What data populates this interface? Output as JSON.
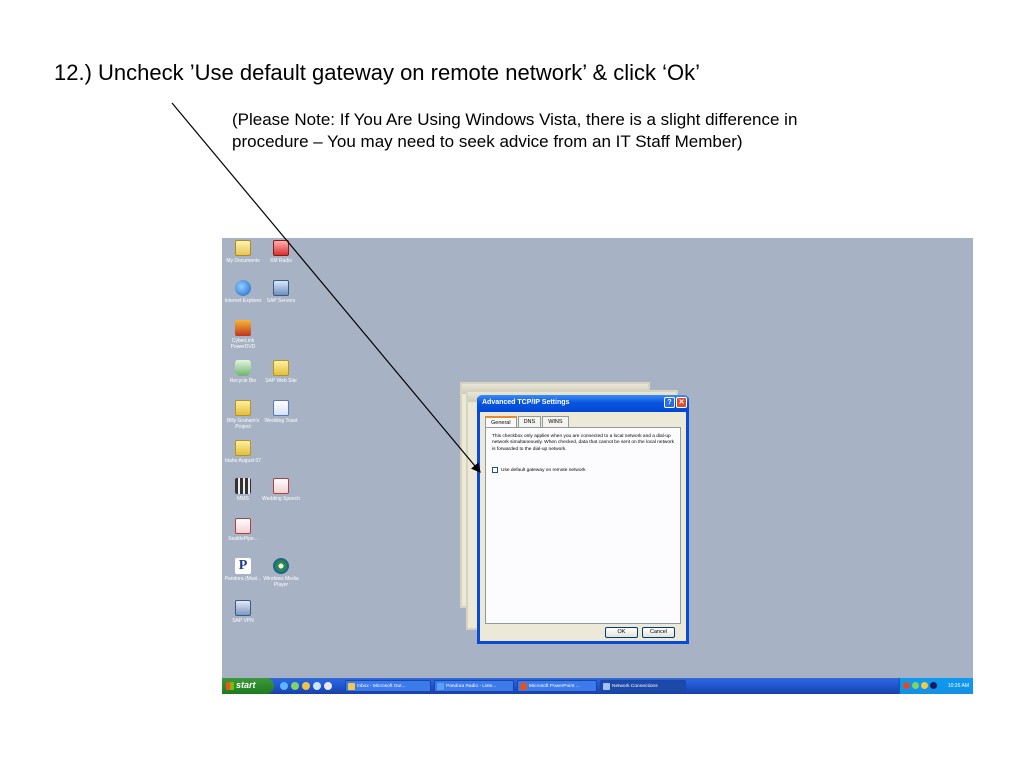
{
  "slide": {
    "title": "12.) Uncheck ’Use default gateway on remote network’ & click ‘Ok’",
    "note_line1": "(Please Note:  If You Are Using Windows Vista, there is a slight difference  in",
    "note_line2": "procedure – You may need to seek advice from an IT Staff Member)"
  },
  "desktop": {
    "background": "#a7b3c4",
    "icons": [
      {
        "label": "My Documents",
        "icon": "my-documents-icon"
      },
      {
        "label": "XM Radio",
        "icon": "xm-radio-icon"
      },
      {
        "label": "Internet Explorer",
        "icon": "internet-explorer-icon"
      },
      {
        "label": "SAP Servers",
        "icon": "sap-servers-icon"
      },
      {
        "label": "CyberLink PowerDVD",
        "icon": "powerdvd-icon"
      },
      {
        "label": "Recycle Bin",
        "icon": "recycle-bin-icon"
      },
      {
        "label": "SAP Web Site",
        "icon": "sap-web-site-icon"
      },
      {
        "label": "Billy Graham's Project",
        "icon": "folder-icon"
      },
      {
        "label": "Wedding Toast",
        "icon": "word-document-icon"
      },
      {
        "label": "Idaho August 07",
        "icon": "folder-icon"
      },
      {
        "label": "MMS",
        "icon": "mms-icon"
      },
      {
        "label": "Wedding Speech",
        "icon": "word-document-icon"
      },
      {
        "label": "SeattlePipe...",
        "icon": "pdf-icon"
      },
      {
        "label": "Pandora (Musi...",
        "icon": "pandora-icon"
      },
      {
        "label": "Windows Media Player",
        "icon": "media-player-icon"
      },
      {
        "label": "SAP VPN",
        "icon": "vpn-icon"
      }
    ]
  },
  "dialog": {
    "title": "Advanced TCP/IP Settings",
    "help_glyph": "?",
    "close_glyph": "✕",
    "tabs": [
      "General",
      "DNS",
      "WINS"
    ],
    "active_tab": "General",
    "description": "This checkbox only applies when you are connected to a local network and a dial-up network simultaneously.  When checked, data that cannot be sent on the local network is forwarded to the dial-up network.",
    "checkbox_label": "Use default gateway on remote network",
    "checkbox_checked": false,
    "ok_label": "OK",
    "cancel_label": "Cancel"
  },
  "taskbar": {
    "start_label": "start",
    "tasks": [
      {
        "label": "Inbox - Microsoft Out...",
        "color": "#f2c94c"
      },
      {
        "label": "Pandora Radio - Liste...",
        "color": "#5aa1f0"
      },
      {
        "label": "Microsoft PowerPoint ...",
        "color": "#d9542b"
      },
      {
        "label": "Network Connections",
        "color": "#9fc1f5"
      }
    ],
    "active_task": "Network Connections",
    "clock": "10:26 AM"
  }
}
